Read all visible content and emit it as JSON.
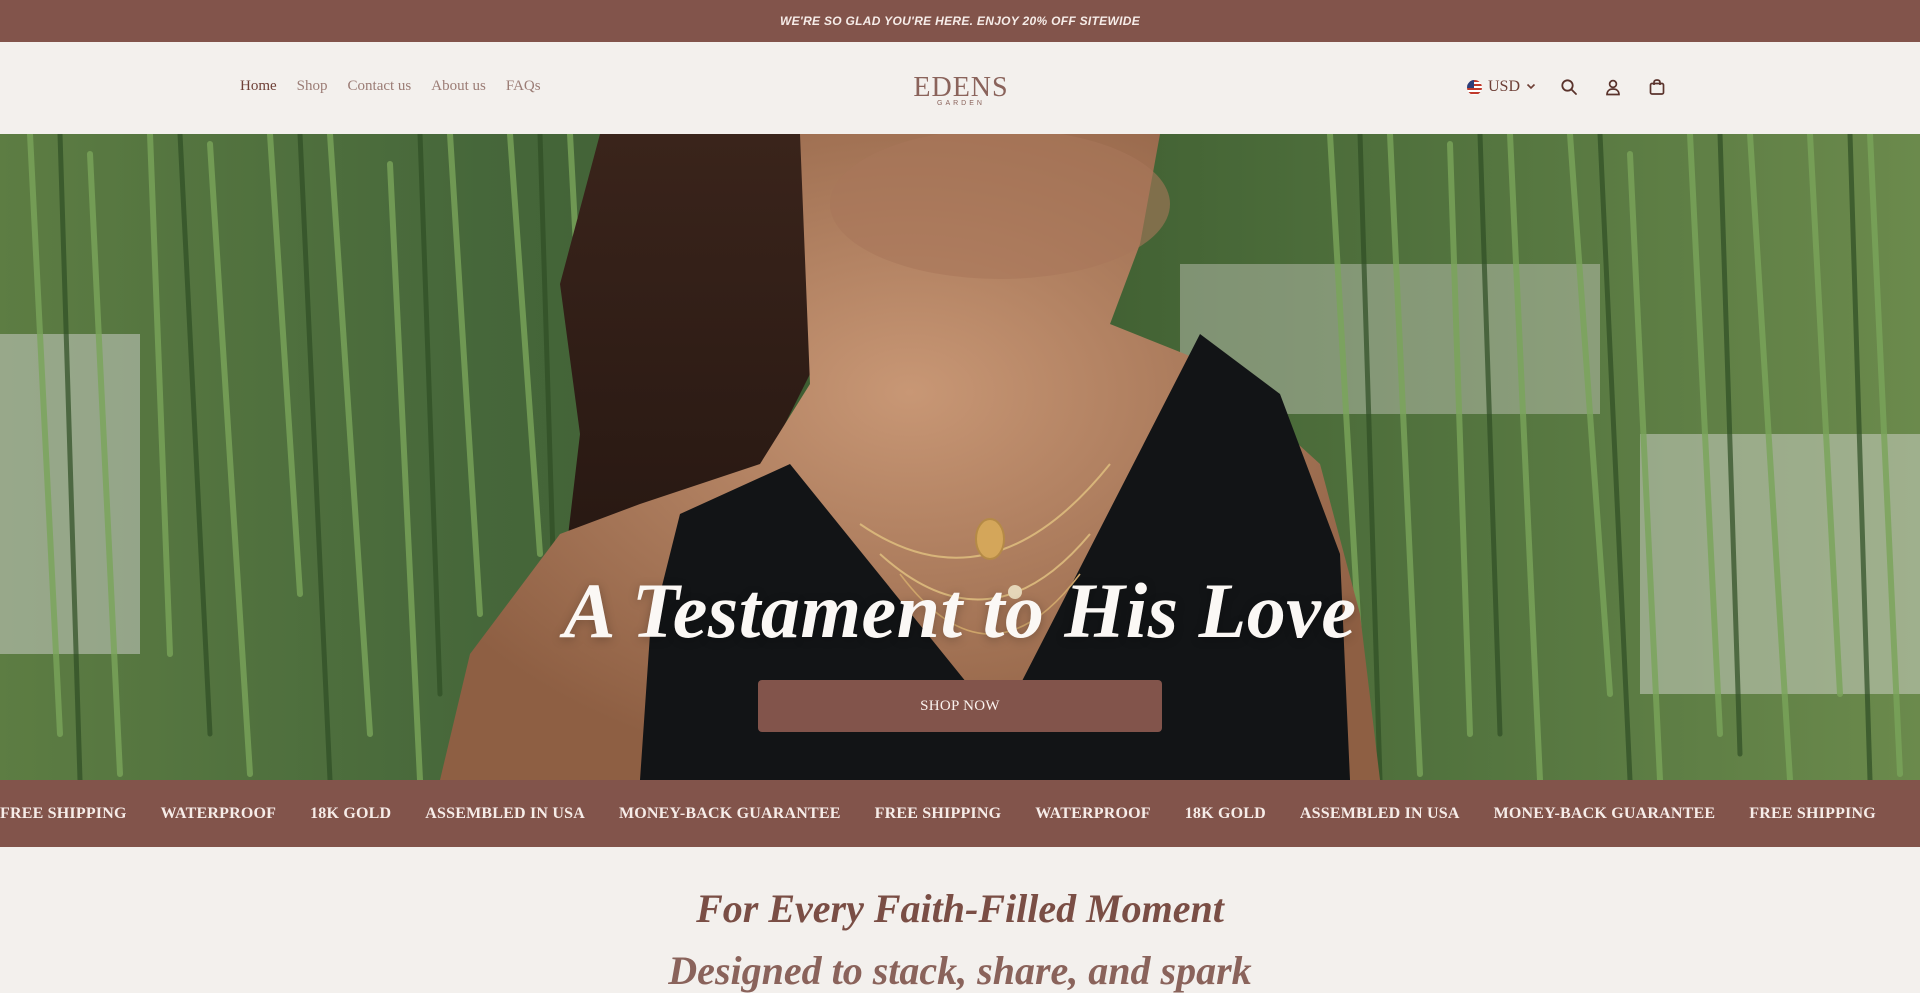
{
  "announcement": {
    "text": "WE'RE SO GLAD YOU'RE HERE. ENJOY 20% OFF SITEWIDE"
  },
  "nav": {
    "items": [
      {
        "label": "Home",
        "active": true
      },
      {
        "label": "Shop",
        "active": false
      },
      {
        "label": "Contact us",
        "active": false
      },
      {
        "label": "About us",
        "active": false
      },
      {
        "label": "FAQs",
        "active": false
      }
    ]
  },
  "logo": {
    "main": "EDENS",
    "sub": "GARDEN"
  },
  "tools": {
    "currency": {
      "label": "USD",
      "flag_icon": "us-flag-icon",
      "dropdown_icon": "chevron-down-icon"
    },
    "search_icon": "search-icon",
    "account_icon": "user-icon",
    "cart_icon": "bag-icon"
  },
  "hero": {
    "title": "A Testament to His Love",
    "button_label": "SHOP NOW"
  },
  "marquee": {
    "items": [
      "FREE SHIPPING",
      "WATERPROOF",
      "18K GOLD",
      "ASSEMBLED IN USA",
      "MONEY-BACK GUARANTEE",
      "FREE SHIPPING",
      "WATERPROOF",
      "18K GOLD",
      "ASSEMBLED IN USA",
      "MONEY-BACK GUARANTEE",
      "FREE SHIPPING"
    ]
  },
  "section": {
    "heading": "For Every Faith-Filled Moment",
    "subheading": "Designed to stack, share, and spark"
  },
  "colors": {
    "brand": "#82544b",
    "background": "#f3f0ed",
    "text": "#7a4e45"
  }
}
